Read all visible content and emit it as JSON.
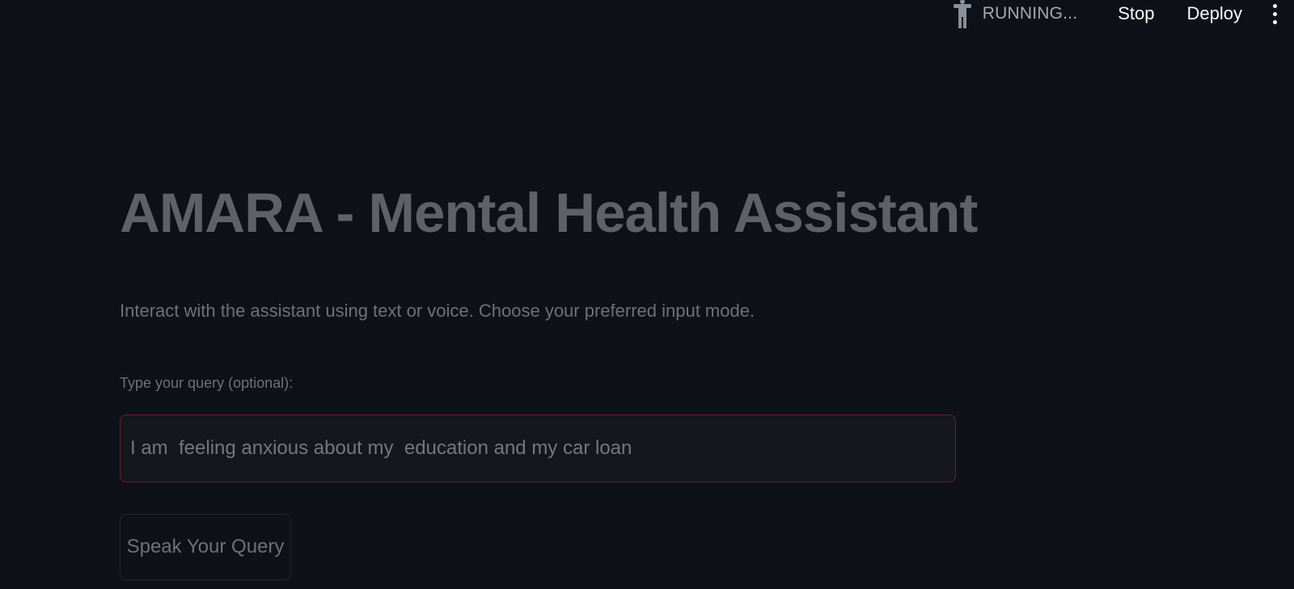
{
  "toolbar": {
    "status_icon": "running-person-icon",
    "status_text": "RUNNING...",
    "stop_label": "Stop",
    "deploy_label": "Deploy",
    "menu_icon": "vertical-ellipsis-icon"
  },
  "main": {
    "title": "AMARA - Mental Health Assistant",
    "description": "Interact with the assistant using text or voice. Choose your preferred input mode.",
    "query_label": "Type your query (optional):",
    "query_value": "I am  feeling anxious about my  education and my car loan",
    "speak_button_label": "Speak Your Query"
  },
  "colors": {
    "background": "#0e1117",
    "input_border_focus": "#6b1f26",
    "text_primary": "#fafafa",
    "text_muted": "#6e7179"
  }
}
